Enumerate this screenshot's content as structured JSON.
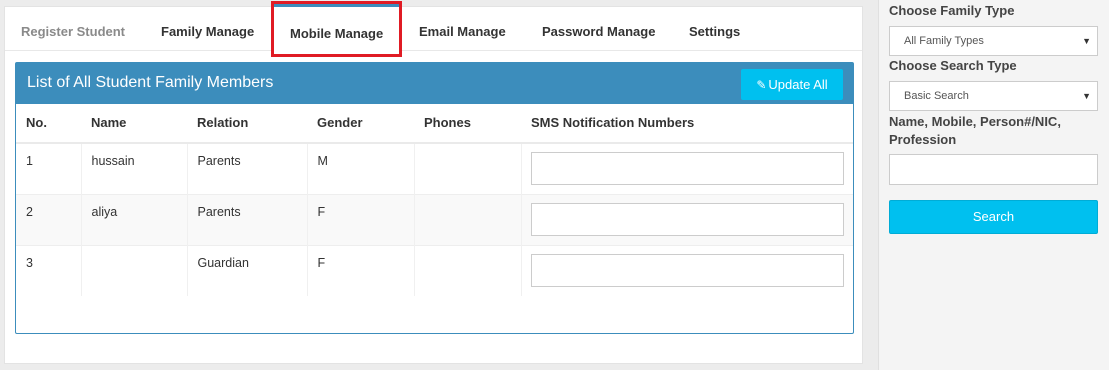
{
  "tabs": [
    {
      "label": "Register Student"
    },
    {
      "label": "Family Manage"
    },
    {
      "label": "Mobile Manage"
    },
    {
      "label": "Email Manage"
    },
    {
      "label": "Password Manage"
    },
    {
      "label": "Settings"
    }
  ],
  "panel": {
    "title": "List of All Student Family Members",
    "update_label": "Update All",
    "update_icon": "edit-icon"
  },
  "table": {
    "headers": [
      "No.",
      "Name",
      "Relation",
      "Gender",
      "Phones",
      "SMS Notification Numbers"
    ],
    "rows": [
      {
        "no": "1",
        "name": "hussain",
        "relation": "Parents",
        "gender": "M",
        "phones": "",
        "sms": ""
      },
      {
        "no": "2",
        "name": "aliya",
        "relation": "Parents",
        "gender": "F",
        "phones": "",
        "sms": ""
      },
      {
        "no": "3",
        "name": "",
        "relation": "Guardian",
        "gender": "F",
        "phones": "",
        "sms": ""
      }
    ]
  },
  "sidebar": {
    "family_type_label": "Choose Family Type",
    "family_type_value": "All Family Types",
    "search_type_label": "Choose Search Type",
    "search_type_value": "Basic Search",
    "query_label": "Name, Mobile, Person#/NIC, Profession",
    "query_value": "",
    "search_label": "Search"
  },
  "colors": {
    "primary": "#3c8dbc",
    "info": "#00c0ef",
    "highlight": "#e01b24"
  }
}
